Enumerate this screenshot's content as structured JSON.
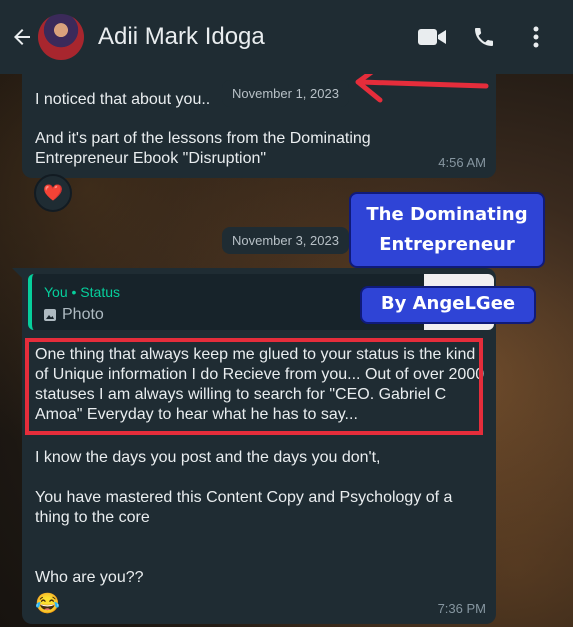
{
  "header": {
    "contact_name": "Adii Mark Idoga",
    "icons": [
      "back-arrow-icon",
      "video-call-icon",
      "phone-icon",
      "more-vert-icon"
    ]
  },
  "messages": {
    "first": {
      "line1": "I noticed that about you..",
      "line2": "And it's part of the lessons from the Dominating Entrepreneur Ebook \"Disruption\"",
      "time": "4:56 AM",
      "reaction": "❤️"
    },
    "date1": "November 1, 2023",
    "date2": "November 3, 2023",
    "second": {
      "quote_author": "You • Status",
      "quote_type": "Photo",
      "highlighted": "One thing that always keep me glued to your status is the kind of Unique information I do Recieve from you... Out of over 2000 statuses I am always willing to search for \"CEO. Gabriel C Amoa\" Everyday to hear what he has to say...",
      "p1": "I know the days you post and the days you don't,",
      "p2": "You have mastered this Content Copy and Psychology of a thing to the core",
      "p3": "Who are you??",
      "emoji": "😂",
      "time": "7:36 PM"
    }
  },
  "overlay": {
    "title_line1": "The Dominating",
    "title_line2": "Entrepreneur",
    "byline": "By AngeLGee"
  },
  "colors": {
    "header_bg": "#1f2c33",
    "bubble_bg": "#1f2c33",
    "accent_green": "#06cf9c",
    "highlight_red": "#e52d3b",
    "overlay_blue": "#2f44d6"
  }
}
